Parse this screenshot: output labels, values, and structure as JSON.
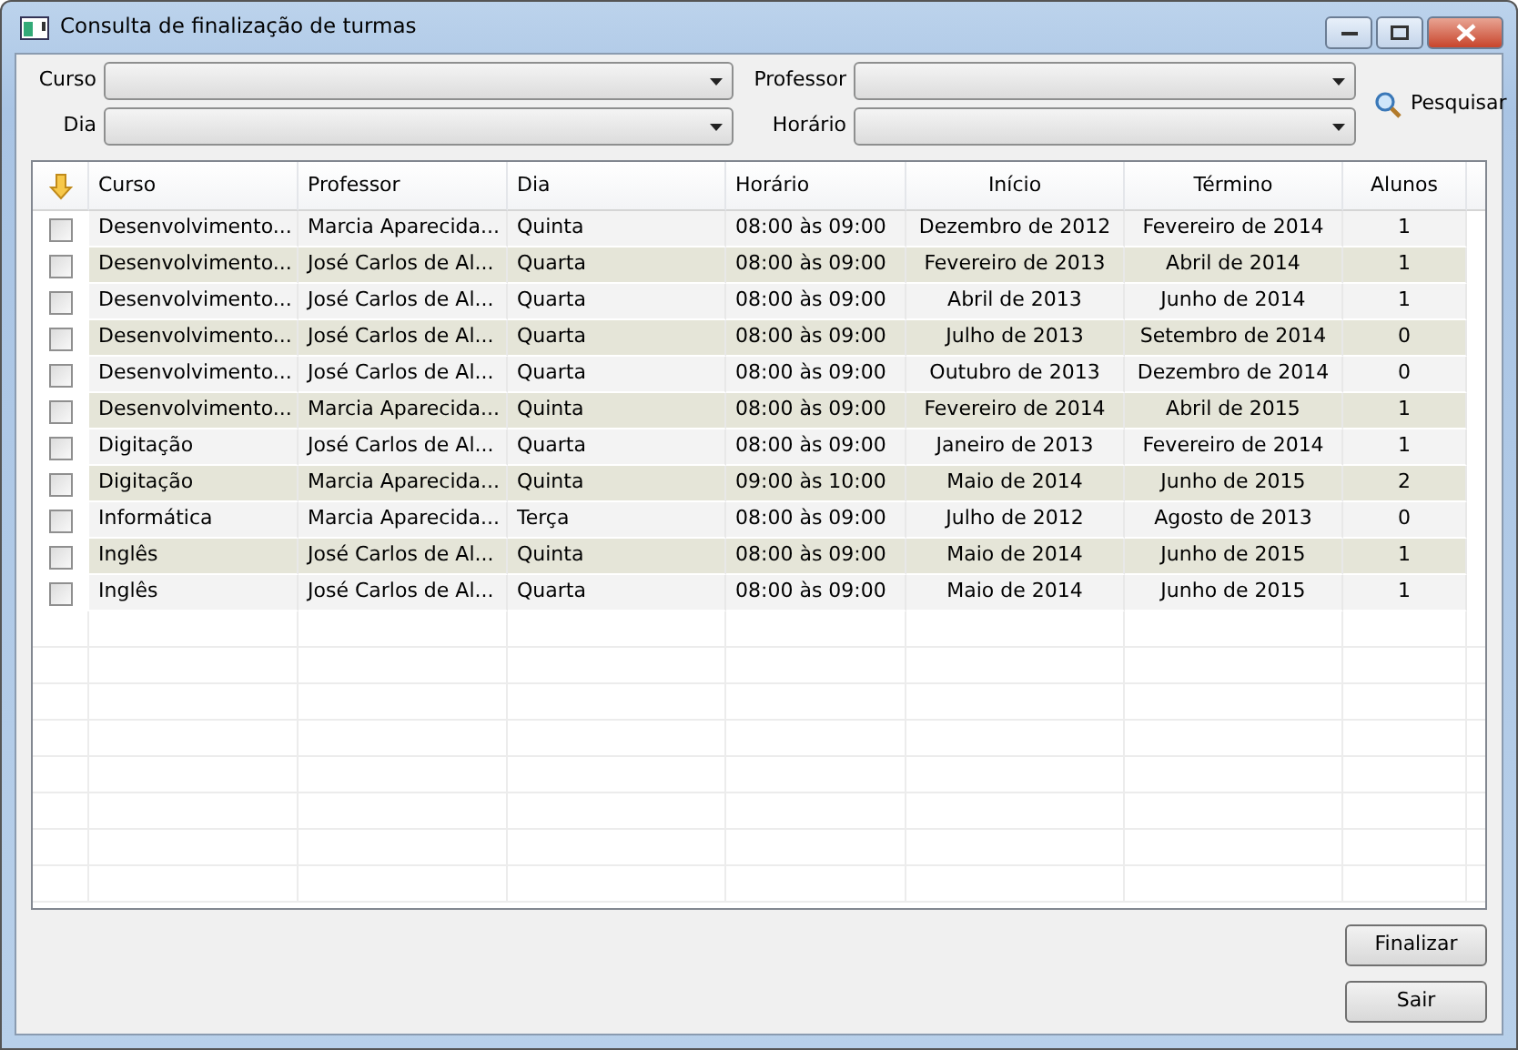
{
  "window": {
    "title": "Consulta de finalização de turmas"
  },
  "filters": [
    {
      "label": "Curso"
    },
    {
      "label": "Professor"
    },
    {
      "label": "Dia"
    },
    {
      "label": "Horário"
    }
  ],
  "search_button": "Pesquisar",
  "table": {
    "columns": [
      {
        "label": "Curso"
      },
      {
        "label": "Professor"
      },
      {
        "label": "Dia"
      },
      {
        "label": "Horário"
      },
      {
        "label": "Início"
      },
      {
        "label": "Término"
      },
      {
        "label": "Alunos"
      }
    ],
    "rows": [
      {
        "checked": false,
        "cells": [
          "Desenvolvimento...",
          "Marcia Aparecida...",
          "Quinta",
          "08:00 às 09:00",
          "Dezembro de 2012",
          "Fevereiro de 2014",
          "1"
        ]
      },
      {
        "checked": false,
        "cells": [
          "Desenvolvimento...",
          "José Carlos de Al...",
          "Quarta",
          "08:00 às 09:00",
          "Fevereiro de 2013",
          "Abril de 2014",
          "1"
        ]
      },
      {
        "checked": false,
        "cells": [
          "Desenvolvimento...",
          "José Carlos de Al...",
          "Quarta",
          "08:00 às 09:00",
          "Abril de 2013",
          "Junho de 2014",
          "1"
        ]
      },
      {
        "checked": false,
        "cells": [
          "Desenvolvimento...",
          "José Carlos de Al...",
          "Quarta",
          "08:00 às 09:00",
          "Julho de 2013",
          "Setembro de 2014",
          "0"
        ]
      },
      {
        "checked": false,
        "cells": [
          "Desenvolvimento...",
          "José Carlos de Al...",
          "Quarta",
          "08:00 às 09:00",
          "Outubro de 2013",
          "Dezembro de 2014",
          "0"
        ]
      },
      {
        "checked": false,
        "cells": [
          "Desenvolvimento...",
          "Marcia Aparecida...",
          "Quinta",
          "08:00 às 09:00",
          "Fevereiro de 2014",
          "Abril de 2015",
          "1"
        ]
      },
      {
        "checked": false,
        "cells": [
          "Digitação",
          "José Carlos de Al...",
          "Quarta",
          "08:00 às 09:00",
          "Janeiro de 2013",
          "Fevereiro de 2014",
          "1"
        ]
      },
      {
        "checked": false,
        "cells": [
          "Digitação",
          "Marcia Aparecida...",
          "Quinta",
          "09:00 às 10:00",
          "Maio de 2014",
          "Junho de 2015",
          "2"
        ]
      },
      {
        "checked": false,
        "cells": [
          "Informática",
          "Marcia Aparecida...",
          "Terça",
          "08:00 às 09:00",
          "Julho de 2012",
          "Agosto de 2013",
          "0"
        ]
      },
      {
        "checked": false,
        "cells": [
          "Inglês",
          "José Carlos de Al...",
          "Quinta",
          "08:00 às 09:00",
          "Maio de 2014",
          "Junho de 2015",
          "1"
        ]
      },
      {
        "checked": false,
        "cells": [
          "Inglês",
          "José Carlos de Al...",
          "Quarta",
          "08:00 às 09:00",
          "Maio de 2014",
          "Junho de 2015",
          "1"
        ]
      }
    ]
  },
  "buttons": [
    "Finalizar",
    "Sair"
  ]
}
